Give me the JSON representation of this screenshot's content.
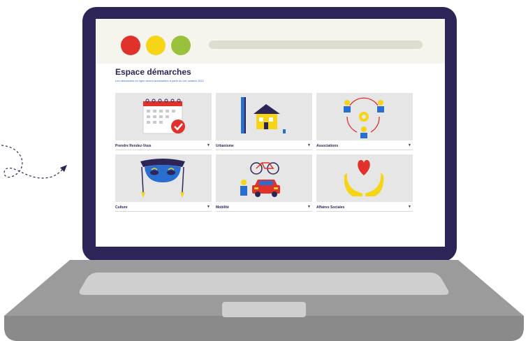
{
  "espace": {
    "title": "Espace démarches",
    "subtitle": "Les démarches en ligne seront accessibles à partir du 1er octobre 2021"
  },
  "cards": [
    {
      "label": "Prendre Rendez-Vous",
      "icon": "calendar-check-icon"
    },
    {
      "label": "Urbanisme",
      "icon": "house-blueprint-icon"
    },
    {
      "label": "Associations",
      "icon": "people-gear-icon"
    },
    {
      "label": "Culture",
      "icon": "theatre-mask-icon"
    },
    {
      "label": "Mobilité",
      "icon": "bike-car-icon"
    },
    {
      "label": "Affaires Sociales",
      "icon": "heart-hands-icon"
    }
  ],
  "colors": {
    "frame": "#2d2558",
    "accent_red": "#e0312b",
    "accent_yellow": "#f6d416",
    "accent_green": "#99c13b",
    "accent_blue": "#2a6fd0"
  }
}
